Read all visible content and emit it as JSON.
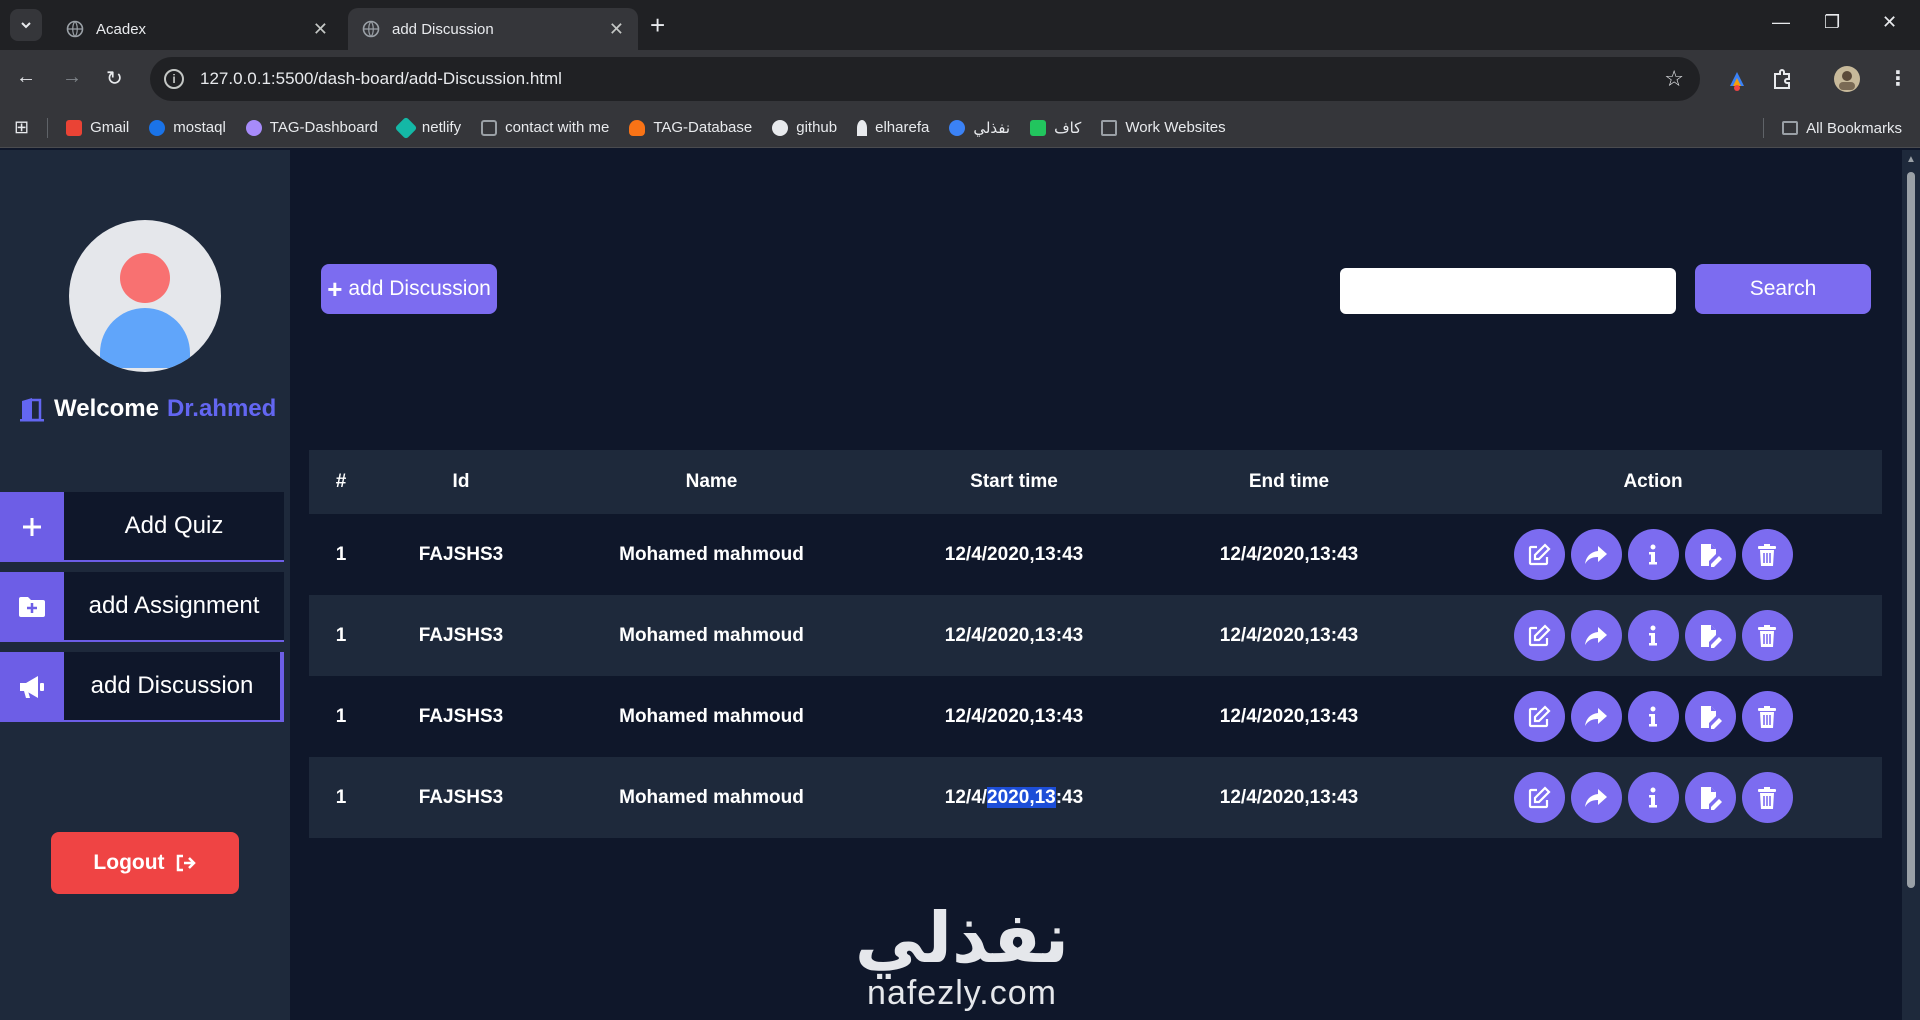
{
  "browser": {
    "tabs": [
      {
        "title": "Acadex"
      },
      {
        "title": "add Discussion"
      }
    ],
    "url": "127.0.0.1:5500/dash-board/add-Discussion.html",
    "bookmarks": [
      {
        "label": "Gmail",
        "color": "#ea4335"
      },
      {
        "label": "mostaql",
        "color": "#1a73e8"
      },
      {
        "label": "TAG-Dashboard",
        "color": "#a78bfa"
      },
      {
        "label": "netlify",
        "color": "#14b8a6"
      },
      {
        "label": "contact with me",
        "color": "#9aa0a6"
      },
      {
        "label": "TAG-Database",
        "color": "#f97316"
      },
      {
        "label": "github",
        "color": "#e8eaed"
      },
      {
        "label": "elharefa",
        "color": "#e8eaed"
      },
      {
        "label": "نفذلي",
        "color": "#3b82f6"
      },
      {
        "label": "كاف",
        "color": "#22c55e"
      },
      {
        "label": "Work Websites",
        "color": "#9aa0a6"
      }
    ],
    "all_bookmarks": "All Bookmarks"
  },
  "sidebar": {
    "welcome": "Welcome",
    "user": "Dr.ahmed",
    "items": [
      {
        "label": "Add Quiz"
      },
      {
        "label": "add Assignment"
      },
      {
        "label": "add Discussion"
      }
    ],
    "logout": "Logout"
  },
  "main": {
    "add_button": "add Discussion",
    "search_placeholder": "",
    "search_button": "Search",
    "table": {
      "headers": [
        "#",
        "Id",
        "Name",
        "Start time",
        "End time",
        "Action"
      ],
      "rows": [
        {
          "num": "1",
          "id": "FAJSHS3",
          "name": "Mohamed mahmoud",
          "start": "12/4/2020,13:43",
          "end": "12/4/2020,13:43"
        },
        {
          "num": "1",
          "id": "FAJSHS3",
          "name": "Mohamed mahmoud",
          "start": "12/4/2020,13:43",
          "end": "12/4/2020,13:43"
        },
        {
          "num": "1",
          "id": "FAJSHS3",
          "name": "Mohamed mahmoud",
          "start": "12/4/2020,13:43",
          "end": "12/4/2020,13:43"
        },
        {
          "num": "1",
          "id": "FAJSHS3",
          "name": "Mohamed mahmoud",
          "start": "12/4/2020,13:43",
          "end": "12/4/2020,13:43"
        }
      ]
    },
    "last_row_start_parts": [
      "12/4/",
      "2020,13",
      ":43"
    ]
  },
  "watermark": {
    "arabic": "نفذلي",
    "latin": "nafezly.com"
  },
  "colors": {
    "accent": "#7c6cf0",
    "logout": "#ef4444",
    "bg": "#0f172a",
    "panel": "#1e293b"
  }
}
